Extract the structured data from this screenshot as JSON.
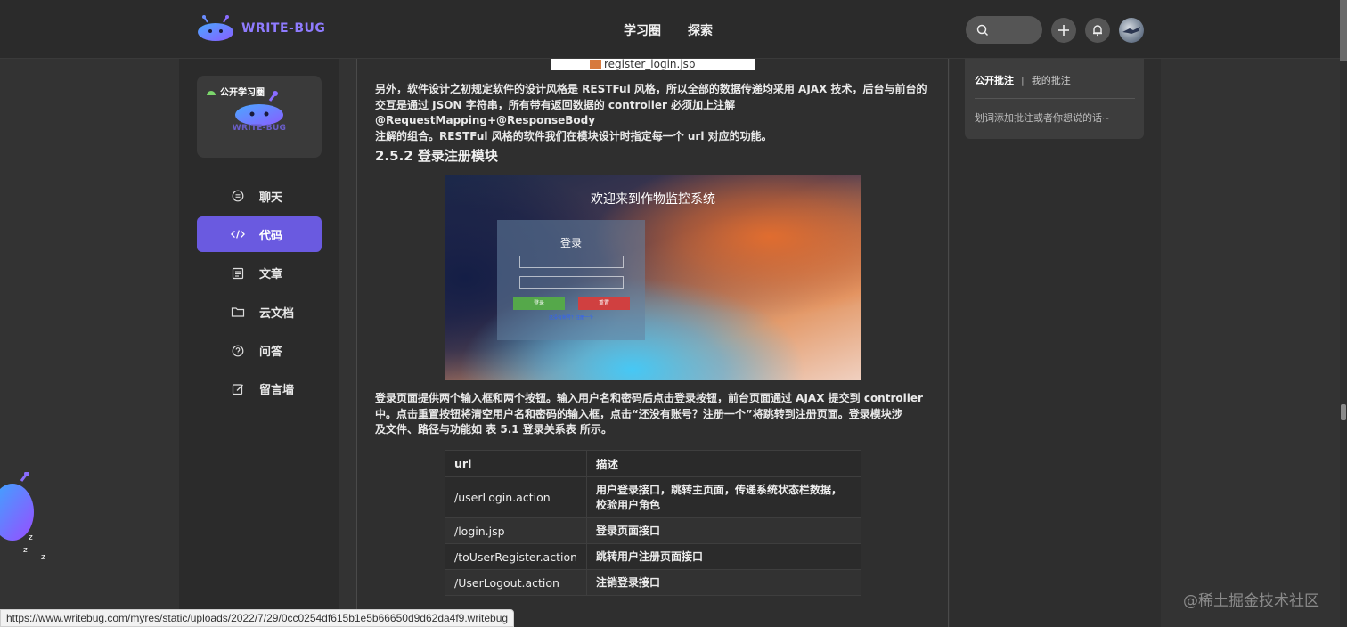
{
  "brand": {
    "name": "WRITE-BUG"
  },
  "nav": {
    "items": [
      "学习圈",
      "探索"
    ]
  },
  "circle": {
    "tag": "公开学习圈",
    "name": "WRITE-BUG"
  },
  "sidebar": {
    "items": [
      {
        "label": "聊天",
        "icon": "chat-icon"
      },
      {
        "label": "代码",
        "icon": "code-icon",
        "active": true
      },
      {
        "label": "文章",
        "icon": "article-icon"
      },
      {
        "label": "云文档",
        "icon": "folder-icon"
      },
      {
        "label": "问答",
        "icon": "question-icon"
      },
      {
        "label": "留言墙",
        "icon": "edit-icon"
      }
    ]
  },
  "article": {
    "file_chip": "register_login.jsp",
    "para1_line1": "另外，软件设计之初规定软件的设计风格是 RESTFul 风格，所以全部的数据传递均采用 AJAX 技术，后台与前台的",
    "para1_line2": "交互是通过 JSON 字符串，所有带有返回数据的 controller 必须加上注解@RequestMapping+@ResponseBody",
    "para1_line3": "注解的组合。RESTFul 风格的软件我们在模块设计时指定每一个 url 对应的功能。",
    "heading": "2.5.2 登录注册模块",
    "screenshot": {
      "title": "欢迎来到作物监控系统",
      "login_title": "登录",
      "btn_login": "登录",
      "btn_reset": "重置",
      "register_link": "还没有账号？注册一个"
    },
    "para2_line1": "登录页面提供两个输入框和两个按钮。输入用户名和密码后点击登录按钮，前台页面通过 AJAX 提交到 controller",
    "para2_line2": "中。点击重置按钮将清空用户名和密码的输入框，点击“还没有账号？注册一个”将跳转到注册页面。登录模块涉",
    "para2_line3": "及文件、路径与功能如 表 5.1 登录关系表 所示。",
    "table": {
      "headers": [
        "url",
        "描述"
      ],
      "rows": [
        [
          "/userLogin.action",
          "用户登录接口，跳转主页面，传递系统状态栏数据，校验用户角色"
        ],
        [
          "/login.jsp",
          "登录页面接口"
        ],
        [
          "/toUserRegister.action",
          "跳转用户注册页面接口"
        ],
        [
          "/UserLogout.action",
          "注销登录接口"
        ]
      ]
    }
  },
  "comments": {
    "tab_public": "公开批注",
    "separator": "|",
    "tab_mine": "我的批注",
    "hint": "划词添加批注或者你想说的话~"
  },
  "status_url": "https://www.writebug.com/myres/static/uploads/2022/7/29/0cc0254df615b1e5b66650d9d62da4f9.writebug",
  "watermark": "@稀土掘金技术社区",
  "colors": {
    "accent": "#6a5ae0",
    "topbar": "#2b2b2b",
    "background": "#333333"
  }
}
